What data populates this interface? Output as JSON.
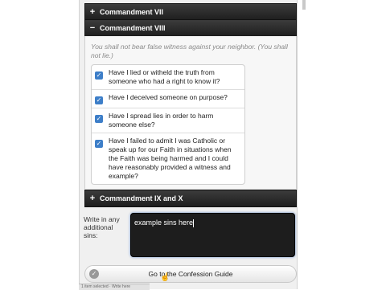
{
  "accordion": {
    "section_vii": {
      "symbol": "+",
      "label": "Commandment VII"
    },
    "section_viii": {
      "symbol": "−",
      "label": "Commandment VIII"
    },
    "section_ix_x": {
      "symbol": "+",
      "label": "Commandment IX and X"
    }
  },
  "viii": {
    "quote": "You shall not bear false witness against your neighbor. (You shall not lie.)",
    "items": [
      {
        "label": "Have I lied or witheld the truth from someone who had a right to know it?",
        "checked": true
      },
      {
        "label": "Have I deceived someone on purpose?",
        "checked": true
      },
      {
        "label": "Have I spread lies in order to harm someone else?",
        "checked": true
      },
      {
        "label": "Have I failed to admit I was Catholic or speak up for our Faith in situations when the Faith was being harmed and I could have reasonably provided a witness and example?",
        "checked": true
      }
    ]
  },
  "additional": {
    "label": "Write in any additional sins:",
    "value": "example sins here"
  },
  "guide_button": {
    "label": "Go to the Confession Guide"
  },
  "status_bar": {
    "text": "1 item selected · Write here"
  },
  "colors": {
    "header_bg": "#2b2b2b",
    "checkbox": "#3d7ec8",
    "textarea_bg": "#1d1d1d",
    "quote_text": "#8a8a8a"
  }
}
